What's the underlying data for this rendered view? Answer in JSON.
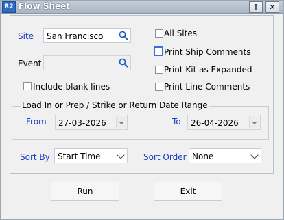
{
  "window": {
    "title": "Flow Sheet",
    "icon_text": "R2",
    "restore_glyph": "↑",
    "close_glyph": "✕"
  },
  "site": {
    "label": "Site",
    "value": "San Francisco"
  },
  "event": {
    "label": "Event",
    "value": ""
  },
  "checkboxes": {
    "all_sites": "All Sites",
    "print_ship_comments": "Print Ship Comments",
    "print_kit_expanded": "Print Kit as Expanded",
    "include_blank_lines": "Include blank lines",
    "print_line_comments": "Print Line Comments"
  },
  "date_range": {
    "title": "Load In or Prep / Strike or Return Date Range",
    "from_label": "From",
    "from_value": "27-03-2026",
    "to_label": "To",
    "to_value": "26-04-2026"
  },
  "sort_by": {
    "label": "Sort By",
    "value": "Start Time"
  },
  "sort_order": {
    "label": "Sort Order",
    "value": "None"
  },
  "buttons": {
    "run_mnemonic": "R",
    "run_rest": "un",
    "exit_pre": "E",
    "exit_mnemonic": "x",
    "exit_rest": "it"
  },
  "colors": {
    "label_accent": "#1f3fc4",
    "title_bar": "#aab6c4"
  }
}
